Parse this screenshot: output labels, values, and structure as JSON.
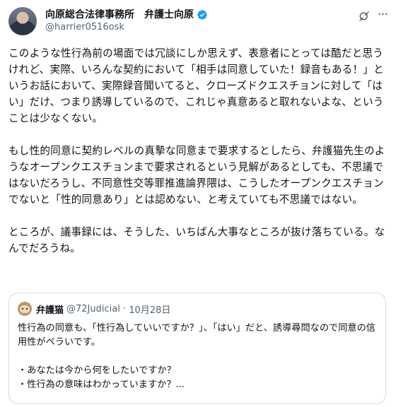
{
  "post": {
    "author": {
      "display_name": "向原総合法律事務所　弁護士向原",
      "handle": "@harrier0516osk",
      "verified_color": "#1d9bf0"
    },
    "icons": {
      "grok": "grok-icon",
      "more": "more-icon"
    },
    "paragraphs": [
      "このような性行為前の場面では冗談にしか思えず、表意者にとっては酷だと思うけれど、実際、いろんな契約において「相手は同意していた！録音もある！」というお話において、実際録音聞いてると、クローズドクエスチョンに対して「はい」だけ、つまり誘導しているので、これじゃ真意あると取れないよな、ということは少なくない。",
      "もし性的同意に契約レベルの真摯な同意まで要求するとしたら、弁護猫先生のようなオープンクエスチョンまで要求されるという見解があるとしても、不思議ではないだろうし、不同意性交等罪推進論界隈は、こうしたオープンクエスチョンでないと「性的同意あり」とは認めない、と考えていても不思議ではない。",
      "ところが、議事録には、そうした、いちばん大事なところが抜け落ちている。なんでだろうね。"
    ]
  },
  "quote": {
    "author_name": "弁護猫",
    "handle": "@72Judicial",
    "date": "10月28日",
    "line1": "性行為の同意も、「性行為していいですか？」、「はい」だと、誘導尋問なので同意の信用性がペラいです。",
    "bullet1": "・あなたは今から何をしたいですか？",
    "bullet2": "・性行為の意味はわかっていますか？..."
  }
}
